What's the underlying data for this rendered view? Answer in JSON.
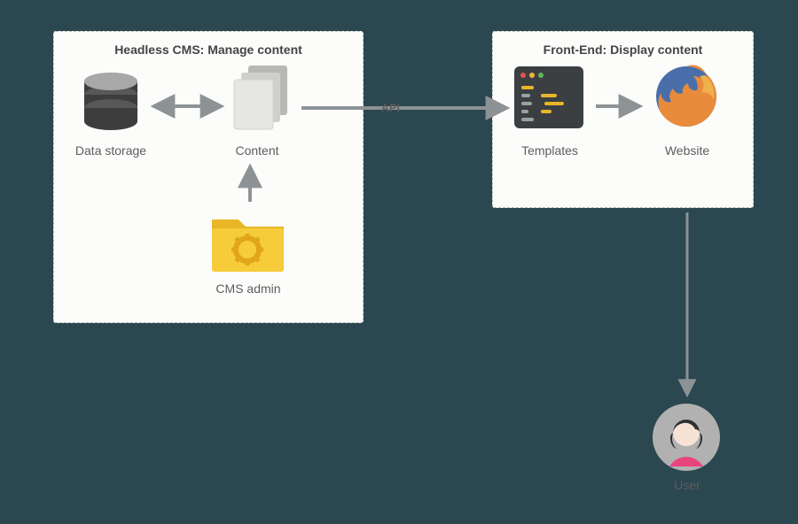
{
  "panels": {
    "left_title": "Headless CMS: Manage content",
    "right_title": "Front-End: Display content"
  },
  "nodes": {
    "data_storage": "Data storage",
    "content": "Content",
    "cms_admin": "CMS admin",
    "templates": "Templates",
    "website": "Website",
    "user": "User"
  },
  "edges": {
    "api_label": "API"
  },
  "connections": [
    {
      "from": "data_storage",
      "to": "content",
      "bidirectional": true
    },
    {
      "from": "cms_admin",
      "to": "content",
      "bidirectional": false
    },
    {
      "from": "content",
      "to": "templates",
      "bidirectional": false,
      "label": "API"
    },
    {
      "from": "templates",
      "to": "website",
      "bidirectional": false
    },
    {
      "from": "website",
      "to": "user",
      "bidirectional": false
    }
  ]
}
